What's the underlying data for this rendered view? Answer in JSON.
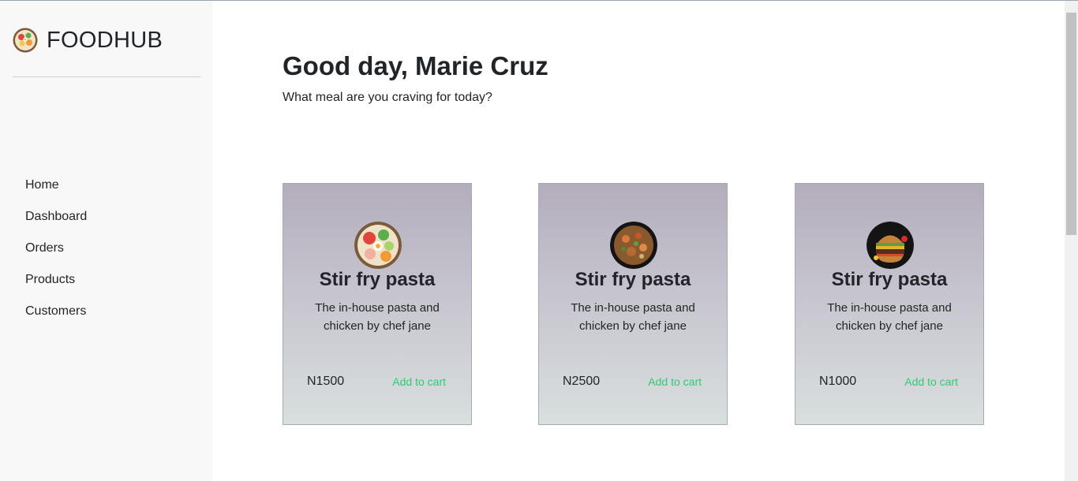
{
  "brand": {
    "name": "FOODHUB",
    "logo_icon": "food-bowl-icon"
  },
  "nav": {
    "items": [
      {
        "label": "Home"
      },
      {
        "label": "Dashboard"
      },
      {
        "label": "Orders"
      },
      {
        "label": "Products"
      },
      {
        "label": "Customers"
      }
    ]
  },
  "main": {
    "greeting": "Good day, Marie Cruz",
    "subtitle": "What meal are you craving for today?"
  },
  "products": [
    {
      "title": "Stir fry pasta",
      "description": "The in-house pasta and chicken by chef jane",
      "price": "N1500",
      "cart_label": "Add to cart",
      "image_icon": "food-bowl-icon"
    },
    {
      "title": "Stir fry pasta",
      "description": "The in-house pasta and chicken by chef jane",
      "price": "N2500",
      "cart_label": "Add to cart",
      "image_icon": "stir-fry-pasta-icon"
    },
    {
      "title": "Stir fry pasta",
      "description": "The in-house pasta and chicken by chef jane",
      "price": "N1000",
      "cart_label": "Add to cart",
      "image_icon": "burger-icon"
    }
  ],
  "colors": {
    "accent_green": "#2ecc71",
    "sidebar_bg": "#f8f8f8",
    "card_gradient_top": "#b4adbc",
    "card_gradient_bottom": "#d9dfdf"
  }
}
